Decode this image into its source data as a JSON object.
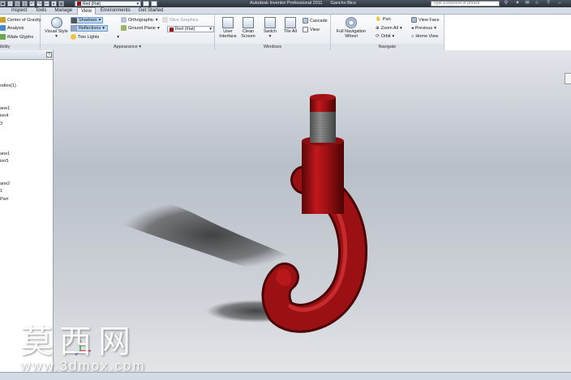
{
  "titlebar": {
    "material": "Red (Flat)",
    "app_title": "Autodesk Inventor Professional 2011",
    "document": "Gancho Bico",
    "search_placeholder": "Type a keyword or phrase"
  },
  "tabs": [
    "Inspect",
    "Tools",
    "Manage",
    "View",
    "Environments",
    "Get Started"
  ],
  "active_tab": "View",
  "ribbon": {
    "visibility": {
      "items": [
        "Center of Gravity",
        "Analysis",
        "iMate Glyphs"
      ],
      "label": "ibility"
    },
    "appearance": {
      "visual_style": "Visual Style",
      "shadows": "Shadows",
      "reflections": "Reflections",
      "lights": "Two Lights",
      "projection": "Orthographic",
      "ground_plane": "Ground Plane",
      "slice_graphics": "Slice Graphics",
      "material": "Red (Flat)",
      "label": "Appearance"
    },
    "windows": {
      "user_interface": [
        "User",
        "Interface"
      ],
      "clean_screen": [
        "Clean",
        "Screen"
      ],
      "switch": "Switch",
      "tile_all": "Tile All",
      "cascade": "Cascade",
      "view": "View",
      "label": "Windows"
    },
    "navigate": {
      "full_nav_wheel": [
        "Full Navigation",
        "Wheel"
      ],
      "pan": "Pan",
      "zoom_all": "Zoom All",
      "orbit": "Orbit",
      "view_face": "View Face",
      "previous": "Previous",
      "home_view": "Home View",
      "label": "Navigate"
    }
  },
  "browser": {
    "items": [
      "",
      "odies(1)",
      "",
      "",
      "ane1",
      "ion4",
      "3",
      "",
      "",
      "",
      "ane1",
      "ion5",
      "",
      "",
      "ane2",
      "1",
      "Part"
    ]
  },
  "watermark": {
    "chinese": "莫西网",
    "url": "www.3dmox.com"
  },
  "colors": {
    "part_red": "#9b1013",
    "ribbon_bg": "#eef1f5",
    "titlebar_bg": "#2f3640"
  }
}
